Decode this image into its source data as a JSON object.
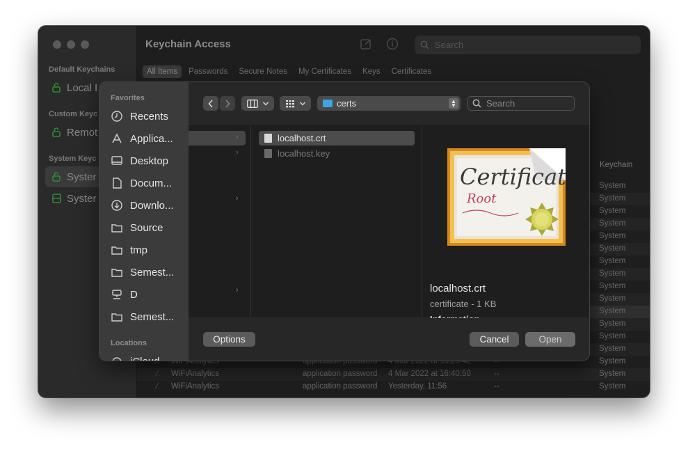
{
  "window": {
    "title": "Keychain Access",
    "search_placeholder": "Search",
    "tabs": [
      "All Items",
      "Passwords",
      "Secure Notes",
      "My Certificates",
      "Keys",
      "Certificates"
    ],
    "sidebar": {
      "default_header": "Default Keychains",
      "custom_header": "Custom Keyc",
      "system_header": "System Keyc",
      "items": [
        "Local I",
        "Remot",
        "Syster",
        "Syster"
      ]
    },
    "column_keychain": "Keychain",
    "keychain_rows": [
      "System",
      "System",
      "System",
      "System",
      "System",
      "System",
      "System",
      "System",
      "System",
      "System",
      "System",
      "System",
      "System",
      "System",
      "System",
      "System"
    ],
    "bottom_rows": [
      {
        "name": "WiFiAnalytics",
        "kind": "application password",
        "date": "4 Mar 2022 at 16:20:42",
        "expires": "--",
        "keychain": "System"
      },
      {
        "name": "WiFiAnalytics",
        "kind": "application password",
        "date": "4 Mar 2022 at 16:40:50",
        "expires": "--",
        "keychain": "System"
      },
      {
        "name": "WiFiAnalytics",
        "kind": "application password",
        "date": "Yesterday, 11:56",
        "expires": "--",
        "keychain": "System"
      }
    ]
  },
  "dialog": {
    "favorites_header": "Favorites",
    "favorites": [
      {
        "label": "Recents",
        "icon": "clock-icon"
      },
      {
        "label": "Applica...",
        "icon": "applications-icon"
      },
      {
        "label": "Desktop",
        "icon": "desktop-icon"
      },
      {
        "label": "Docum...",
        "icon": "document-icon"
      },
      {
        "label": "Downlo...",
        "icon": "download-icon"
      },
      {
        "label": "Source",
        "icon": "folder-icon"
      },
      {
        "label": "tmp",
        "icon": "folder-icon"
      },
      {
        "label": "Semest...",
        "icon": "folder-icon"
      },
      {
        "label": "D",
        "icon": "network-drive-icon"
      },
      {
        "label": "Semest...",
        "icon": "folder-icon"
      }
    ],
    "locations_header": "Locations",
    "locations_item": "iCloud",
    "path_folder": "certs",
    "search_placeholder": "Search",
    "files": [
      {
        "name": "localhost.crt",
        "selected": true
      },
      {
        "name": "localhost.key",
        "selected": false
      }
    ],
    "preview": {
      "name": "localhost.crt",
      "subtitle": "certificate - 1 KB",
      "info": "Information",
      "cert_word": "Certificate",
      "cert_root": "Root"
    },
    "options_label": "Options",
    "cancel_label": "Cancel",
    "open_label": "Open"
  }
}
